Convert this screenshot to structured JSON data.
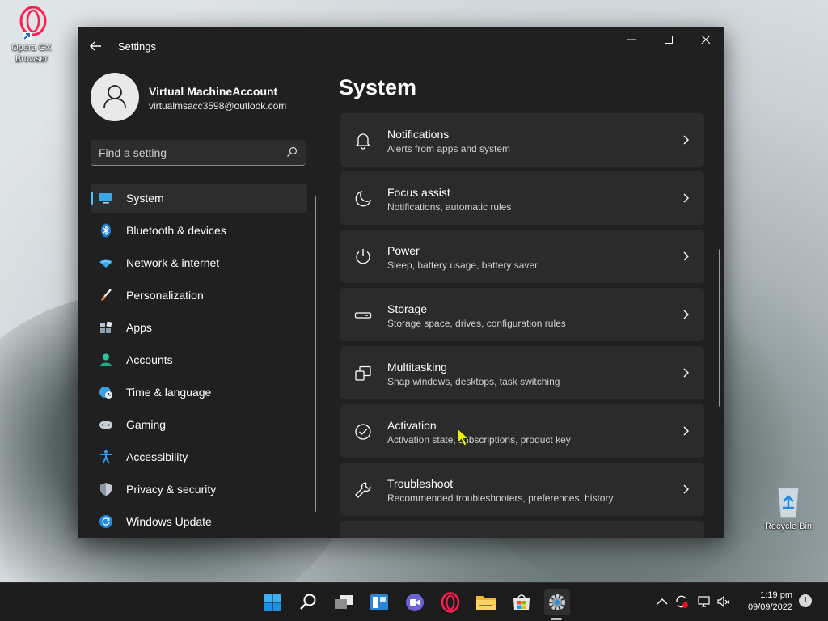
{
  "desktop": {
    "icons": [
      {
        "label_line1": "Opera GX",
        "label_line2": "Browser"
      },
      {
        "label_line1": "Recycle Bin",
        "label_line2": ""
      }
    ]
  },
  "window": {
    "title": "Settings",
    "account": {
      "name": "Virtual MachineAccount",
      "email": "virtualmsacc3598@outlook.com"
    },
    "search": {
      "placeholder": "Find a setting"
    },
    "nav": [
      {
        "label": "System",
        "icon": "monitor-icon",
        "active": true
      },
      {
        "label": "Bluetooth & devices",
        "icon": "bluetooth-icon"
      },
      {
        "label": "Network & internet",
        "icon": "wifi-icon"
      },
      {
        "label": "Personalization",
        "icon": "brush-icon"
      },
      {
        "label": "Apps",
        "icon": "apps-icon"
      },
      {
        "label": "Accounts",
        "icon": "person-icon"
      },
      {
        "label": "Time & language",
        "icon": "globe-clock-icon"
      },
      {
        "label": "Gaming",
        "icon": "gamepad-icon"
      },
      {
        "label": "Accessibility",
        "icon": "accessibility-icon"
      },
      {
        "label": "Privacy & security",
        "icon": "shield-icon"
      },
      {
        "label": "Windows Update",
        "icon": "update-icon"
      }
    ],
    "page": {
      "title": "System",
      "cards": [
        {
          "title": "Notifications",
          "subtitle": "Alerts from apps and system",
          "icon": "bell-icon"
        },
        {
          "title": "Focus assist",
          "subtitle": "Notifications, automatic rules",
          "icon": "moon-icon"
        },
        {
          "title": "Power",
          "subtitle": "Sleep, battery usage, battery saver",
          "icon": "power-icon"
        },
        {
          "title": "Storage",
          "subtitle": "Storage space, drives, configuration rules",
          "icon": "drive-icon"
        },
        {
          "title": "Multitasking",
          "subtitle": "Snap windows, desktops, task switching",
          "icon": "multitask-icon"
        },
        {
          "title": "Activation",
          "subtitle": "Activation state, subscriptions, product key",
          "icon": "check-circle-icon"
        },
        {
          "title": "Troubleshoot",
          "subtitle": "Recommended troubleshooters, preferences, history",
          "icon": "wrench-icon"
        }
      ]
    }
  },
  "taskbar": {
    "icons": [
      "start-icon",
      "search-icon",
      "task-view-icon",
      "widgets-icon",
      "chat-icon",
      "opera-gx-icon",
      "file-explorer-icon",
      "store-icon",
      "settings-icon"
    ],
    "clock": {
      "time": "1:19 pm",
      "date": "09/09/2022"
    },
    "notification_count": "1"
  },
  "colors": {
    "accent": "#4cc2ff",
    "window_bg": "#202020",
    "card_bg": "#2b2b2b"
  }
}
